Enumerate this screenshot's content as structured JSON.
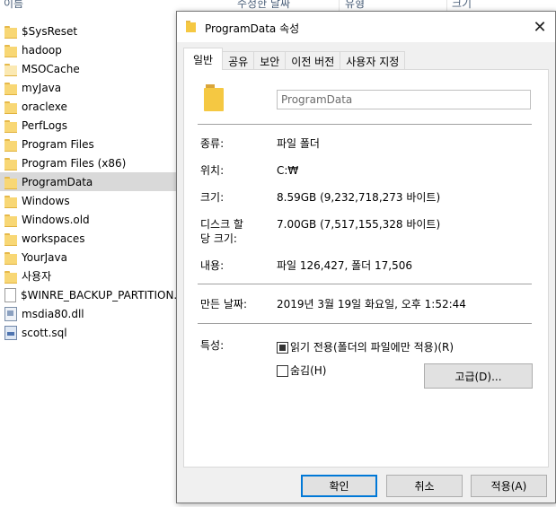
{
  "explorer": {
    "columns": [
      "이름",
      "수정한 날짜",
      "유형",
      "크기"
    ],
    "files": [
      {
        "name": "$SysReset",
        "icon": "folder-icon",
        "selected": false
      },
      {
        "name": "hadoop",
        "icon": "folder-icon",
        "selected": false
      },
      {
        "name": "MSOCache",
        "icon": "folder-icon",
        "selected": false
      },
      {
        "name": "myJava",
        "icon": "folder-icon",
        "selected": false
      },
      {
        "name": "oraclexe",
        "icon": "folder-icon",
        "selected": false
      },
      {
        "name": "PerfLogs",
        "icon": "folder-icon",
        "selected": false
      },
      {
        "name": "Program Files",
        "icon": "folder-icon",
        "selected": false
      },
      {
        "name": "Program Files (x86)",
        "icon": "folder-icon",
        "selected": false
      },
      {
        "name": "ProgramData",
        "icon": "folder-icon",
        "selected": true
      },
      {
        "name": "Windows",
        "icon": "folder-icon",
        "selected": false
      },
      {
        "name": "Windows.old",
        "icon": "folder-icon",
        "selected": false
      },
      {
        "name": "workspaces",
        "icon": "folder-icon",
        "selected": false
      },
      {
        "name": "YourJava",
        "icon": "folder-icon",
        "selected": false
      },
      {
        "name": "사용자",
        "icon": "folder-icon",
        "selected": false
      },
      {
        "name": "$WINRE_BACKUP_PARTITION.MA",
        "icon": "file-icon",
        "selected": false
      },
      {
        "name": "msdia80.dll",
        "icon": "dll-icon",
        "selected": false
      },
      {
        "name": "scott.sql",
        "icon": "sql-icon",
        "selected": false
      }
    ]
  },
  "dialog": {
    "title": "ProgramData 속성",
    "close_glyph": "✕",
    "tabs": [
      "일반",
      "공유",
      "보안",
      "이전 버전",
      "사용자 지정"
    ],
    "active_tab": "일반",
    "folder_name": "ProgramData",
    "props": {
      "type_label": "종류:",
      "type_value": "파일 폴더",
      "location_label": "위치:",
      "location_value": "C:₩",
      "size_label": "크기:",
      "size_value": "8.59GB (9,232,718,273 바이트)",
      "disk_label_1": "디스크 할",
      "disk_label_2": "당 크기:",
      "disk_value": "7.00GB (7,517,155,328 바이트)",
      "contents_label": "내용:",
      "contents_value": "파일 126,427, 폴더 17,506",
      "created_label": "만든 날짜:",
      "created_value": "2019년 3월 19일 화요일, 오후 1:52:44",
      "attributes_label": "특성:",
      "readonly_label": "읽기 전용(폴더의 파일에만 적용)(R)",
      "readonly_checked": true,
      "hidden_label": "숨김(H)",
      "hidden_checked": false,
      "advanced_button": "고급(D)..."
    },
    "buttons": {
      "ok": "확인",
      "cancel": "취소",
      "apply": "적용(A)"
    }
  }
}
